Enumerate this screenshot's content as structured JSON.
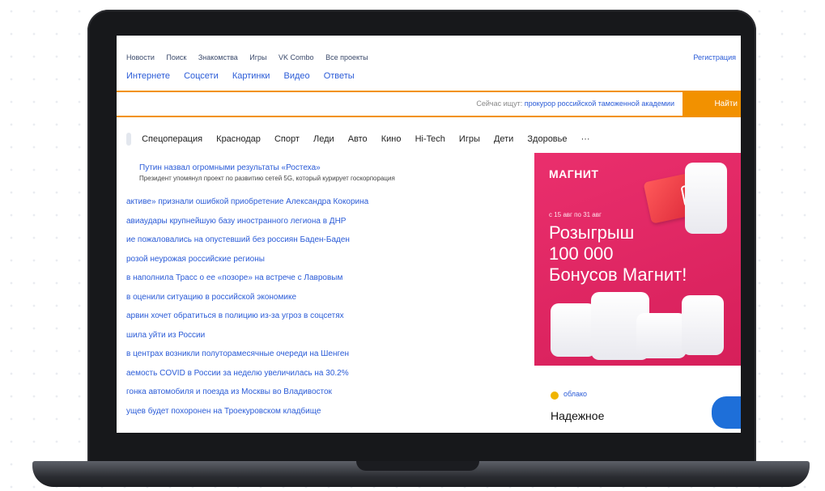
{
  "colors": {
    "accent": "#f29100",
    "link": "#2a5bd7",
    "ad_bg": "#e8316e"
  },
  "topnav": {
    "items": [
      "Новости",
      "Поиск",
      "Знакомства",
      "Игры",
      "VK Combo",
      "Все проекты"
    ],
    "register": "Регистрация"
  },
  "mailnav": {
    "items": [
      "Интернете",
      "Соцсети",
      "Картинки",
      "Видео",
      "Ответы"
    ]
  },
  "search": {
    "hint_prefix": "Сейчас ищут:",
    "hint_link": "прокурор российской таможенной академии",
    "button": "Найти"
  },
  "categories": [
    "Спецоперация",
    "Краснодар",
    "Спорт",
    "Леди",
    "Авто",
    "Кино",
    "Hi-Tech",
    "Игры",
    "Дети",
    "Здоровье",
    "···"
  ],
  "news": {
    "headline": "Путин назвал огромными результаты «Ростеха»",
    "headline_sub": "Президент упомянул проект по развитию сетей 5G, который курирует госкорпорация",
    "items": [
      "активе» признали ошибкой приобретение Александра Кокорина",
      "авиаудары крупнейшую базу иностранного легиона в ДНР",
      "ие пожаловались на опустевший без россиян Баден-Баден",
      "розой неурожая российские регионы",
      "в наполнила Трасс о ее «позоре» на встрече с Лавровым",
      "в оценили ситуацию в российской экономике",
      "арвин хочет обратиться в полицию из-за угроз в соцсетях",
      "шила уйти из России",
      "в центрах возникли полуторамесячные очереди на Шенген",
      "аемость COVID в России за неделю увеличилась на 30.2%",
      "гонка автомобиля и поезда из Москвы во Владивосток",
      "ущев будет похоронен на Троекуровском кладбище"
    ]
  },
  "ad": {
    "brand": "МАГНИТ",
    "card_brand": "М",
    "date": "с 15 авг по 31 авг",
    "title_line1": "Розыгрыш",
    "title_line2": "100 000",
    "title_line3": "Бонусов Магнит!"
  },
  "bottom_card": {
    "tag": "облако",
    "title": "Надежное"
  }
}
